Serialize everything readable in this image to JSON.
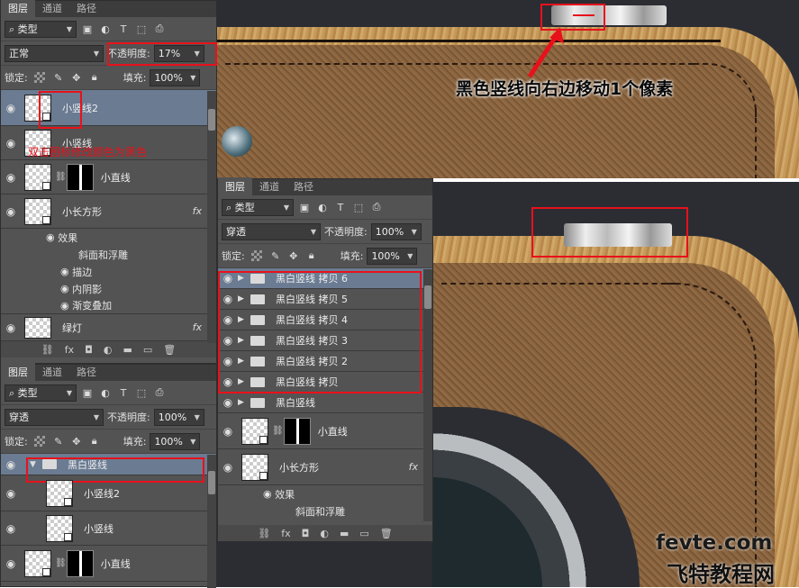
{
  "annotation": "黑色竖线向右边移动1个像素",
  "overlay_note": "双击图标修改颜色为黑色",
  "watermark": {
    "site": "fevte.com",
    "name": "飞特教程网"
  },
  "tabs": [
    "图层",
    "通道",
    "路径"
  ],
  "filter_label": "类型",
  "panel1": {
    "blend": "正常",
    "opacity_label": "不透明度:",
    "opacity": "17%",
    "lock_label": "锁定:",
    "fill_label": "填充:",
    "fill": "100%",
    "layers": [
      "小竖线2",
      "小竖线",
      "小直线",
      "小长方形",
      "绿灯"
    ],
    "effects_label": "效果",
    "effects": [
      "斜面和浮雕",
      "描边",
      "内阴影",
      "渐变叠加"
    ],
    "fx": "fx"
  },
  "panel2": {
    "blend": "穿透",
    "opacity_label": "不透明度:",
    "opacity": "100%",
    "lock_label": "锁定:",
    "fill_label": "填充:",
    "fill": "100%",
    "groups": [
      "黑白竖线 拷贝 6",
      "黑白竖线 拷贝 5",
      "黑白竖线 拷贝 4",
      "黑白竖线 拷贝 3",
      "黑白竖线 拷贝 2",
      "黑白竖线 拷贝",
      "黑白竖线"
    ],
    "layers": [
      "小直线",
      "小长方形"
    ],
    "effects_label": "效果",
    "effect1": "斜面和浮雕",
    "fx": "fx"
  },
  "panel3": {
    "blend": "穿透",
    "opacity_label": "不透明度:",
    "opacity": "100%",
    "lock_label": "锁定:",
    "fill_label": "填充:",
    "fill": "100%",
    "group": "黑白竖线",
    "layers": [
      "小竖线2",
      "小竖线",
      "小直线"
    ]
  },
  "colors": {
    "highlight": "#e8111b",
    "panel": "#535353",
    "selected_row": "#6a7b92"
  }
}
